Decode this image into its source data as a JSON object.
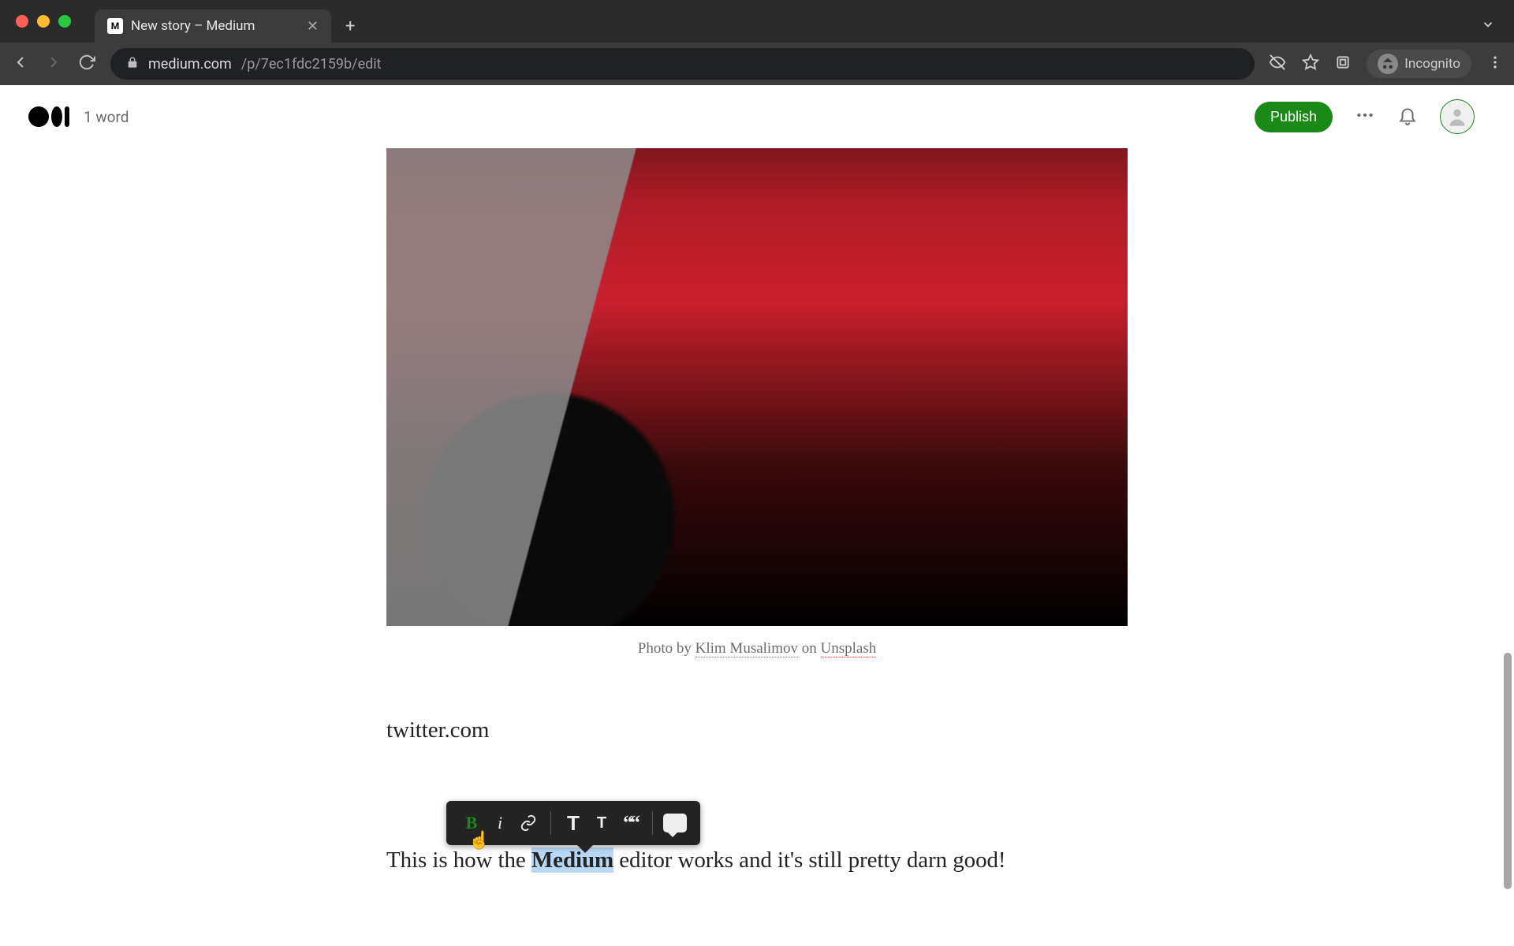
{
  "browser": {
    "tab_title": "New story – Medium",
    "url_host": "medium.com",
    "url_path": "/p/7ec1fdc2159b/edit",
    "incognito_label": "Incognito"
  },
  "topbar": {
    "wordcount": "1 word",
    "publish_label": "Publish"
  },
  "caption": {
    "prefix": "Photo by ",
    "author": "Klim Musalimov",
    "middle": " on ",
    "source": "Unsplash"
  },
  "paragraphs": {
    "p1": "twitter.com",
    "p2_before": "This is how the ",
    "p2_highlight": "Medium",
    "p2_after": " editor works and it's still pretty darn good!"
  },
  "toolbar": {
    "bold": "B",
    "italic": "i",
    "bigT": "T",
    "smallT": "T",
    "quote": "““"
  }
}
